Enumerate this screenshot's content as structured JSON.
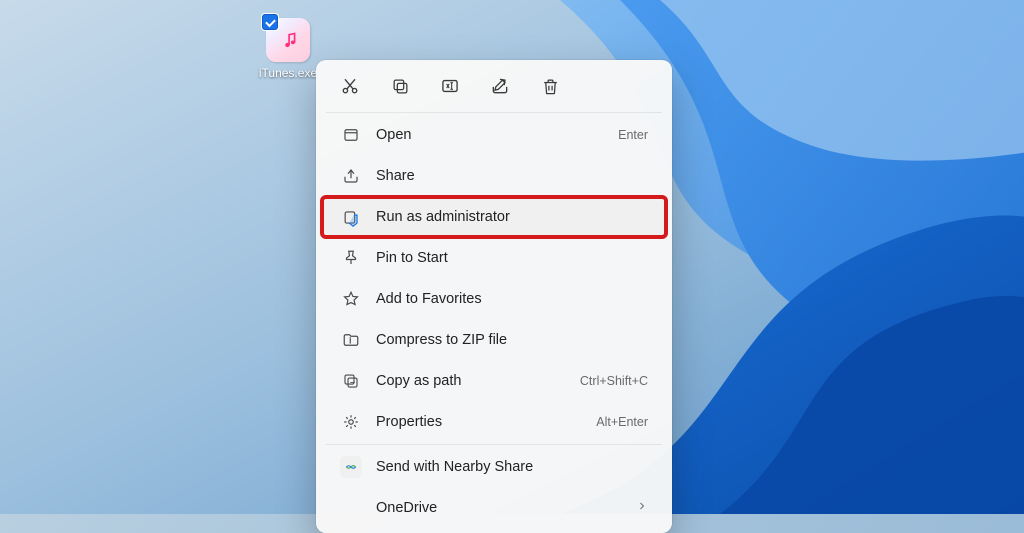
{
  "desktop": {
    "icon_label": "iTunes.exe"
  },
  "toolbar": {
    "cut": "cut-icon",
    "copy": "copy-icon",
    "rename": "rename-icon",
    "share": "share-icon",
    "delete": "delete-icon"
  },
  "menu": {
    "open": {
      "label": "Open",
      "shortcut": "Enter"
    },
    "share": {
      "label": "Share"
    },
    "run_admin": {
      "label": "Run as administrator"
    },
    "pin_start": {
      "label": "Pin to Start"
    },
    "favorites": {
      "label": "Add to Favorites"
    },
    "compress": {
      "label": "Compress to ZIP file"
    },
    "copy_path": {
      "label": "Copy as path",
      "shortcut": "Ctrl+Shift+C"
    },
    "properties": {
      "label": "Properties",
      "shortcut": "Alt+Enter"
    },
    "nearby": {
      "label": "Send with Nearby Share"
    },
    "onedrive": {
      "label": "OneDrive"
    }
  },
  "colors": {
    "highlight_outline": "#d41a1a",
    "accent": "#1a73e8"
  }
}
